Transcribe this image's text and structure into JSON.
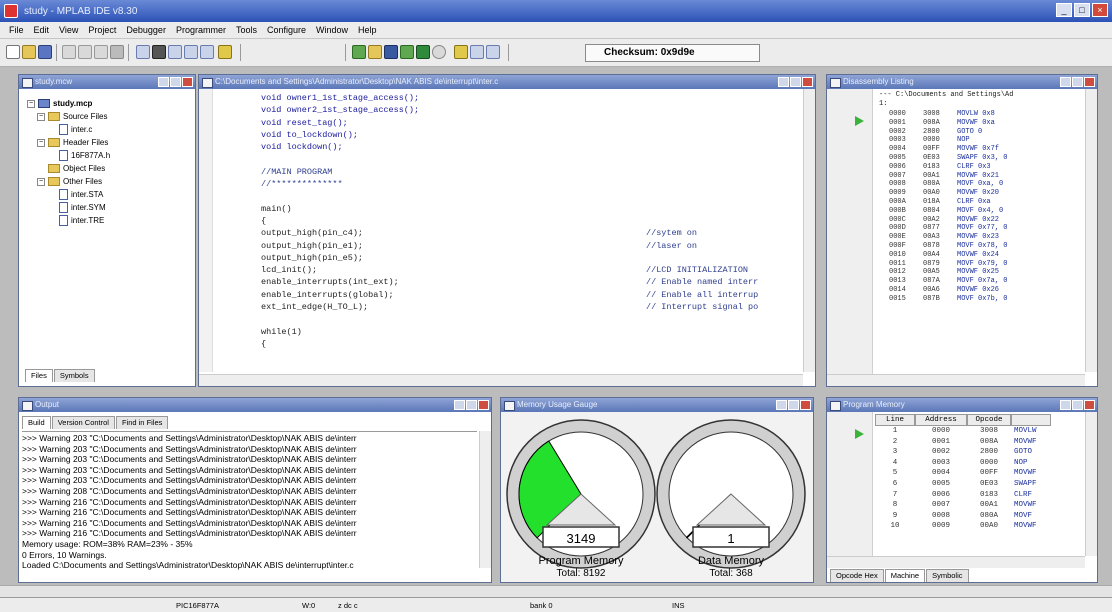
{
  "window": {
    "title": "study - MPLAB IDE v8.30"
  },
  "menu": [
    "File",
    "Edit",
    "View",
    "Project",
    "Debugger",
    "Programmer",
    "Tools",
    "Configure",
    "Window",
    "Help"
  ],
  "toolbar": {
    "checksum_label": "Checksum:",
    "checksum_value": "0x9d9e"
  },
  "project_window": {
    "title": "study.mcw",
    "tree": [
      {
        "label": "study.mcp",
        "type": "project",
        "depth": 0
      },
      {
        "label": "Source Files",
        "type": "folder",
        "depth": 1
      },
      {
        "label": "inter.c",
        "type": "file",
        "depth": 2
      },
      {
        "label": "Header Files",
        "type": "folder",
        "depth": 1
      },
      {
        "label": "16F877A.h",
        "type": "file",
        "depth": 2
      },
      {
        "label": "Object Files",
        "type": "folder",
        "depth": 1
      },
      {
        "label": "Other Files",
        "type": "folder",
        "depth": 1
      },
      {
        "label": "inter.STA",
        "type": "file",
        "depth": 2
      },
      {
        "label": "inter.SYM",
        "type": "file",
        "depth": 2
      },
      {
        "label": "inter.TRE",
        "type": "file",
        "depth": 2
      }
    ],
    "tabs": [
      "Files",
      "Symbols"
    ]
  },
  "editor": {
    "title": "C:\\Documents and Settings\\Administrator\\Desktop\\NAK ABIS de\\interrupt\\inter.c",
    "lines": [
      {
        "code": "void owner1_1st_stage_access();",
        "comment": ""
      },
      {
        "code": "void owner2_1st_stage_access();",
        "comment": ""
      },
      {
        "code": "void reset_tag();",
        "comment": ""
      },
      {
        "code": "void to_lockdown();",
        "comment": ""
      },
      {
        "code": "void lockdown();",
        "comment": ""
      },
      {
        "code": "",
        "comment": ""
      },
      {
        "code": "//MAIN PROGRAM",
        "comment": ""
      },
      {
        "code": "//**************",
        "comment": ""
      },
      {
        "code": "",
        "comment": ""
      },
      {
        "code": "main()",
        "comment": ""
      },
      {
        "code": "{",
        "comment": ""
      },
      {
        "code": "output_high(pin_c4);",
        "comment": "//sytem on"
      },
      {
        "code": "output_high(pin_e1);",
        "comment": "//laser on"
      },
      {
        "code": "output_high(pin_e5);",
        "comment": ""
      },
      {
        "code": "lcd_init();",
        "comment": "//LCD INITIALIZATION"
      },
      {
        "code": "enable_interrupts(int_ext);",
        "comment": "// Enable named interr"
      },
      {
        "code": "enable_interrupts(global);",
        "comment": "// Enable all interrup"
      },
      {
        "code": "ext_int_edge(H_TO_L);",
        "comment": "// Interrupt signal po"
      },
      {
        "code": "",
        "comment": ""
      },
      {
        "code": "while(1)",
        "comment": ""
      },
      {
        "code": "{",
        "comment": ""
      }
    ]
  },
  "disassembly": {
    "title": "Disassembly Listing",
    "header": "--- C:\\Documents and Settings\\Ad",
    "first": "1:",
    "rows": [
      [
        "0000",
        "3008",
        "MOVLW 0x8"
      ],
      [
        "0001",
        "008A",
        "MOVWF 0xa"
      ],
      [
        "0002",
        "2800",
        "GOTO 0"
      ],
      [
        "0003",
        "0000",
        "NOP"
      ],
      [
        "0004",
        "00FF",
        "MOVWF 0x7f"
      ],
      [
        "0005",
        "0E03",
        "SWAPF 0x3, 0"
      ],
      [
        "0006",
        "0183",
        "CLRF 0x3"
      ],
      [
        "0007",
        "00A1",
        "MOVWF 0x21"
      ],
      [
        "0008",
        "080A",
        "MOVF 0xa, 0"
      ],
      [
        "0009",
        "00A0",
        "MOVWF 0x20"
      ],
      [
        "000A",
        "018A",
        "CLRF 0xa"
      ],
      [
        "000B",
        "0804",
        "MOVF 0x4, 0"
      ],
      [
        "000C",
        "00A2",
        "MOVWF 0x22"
      ],
      [
        "000D",
        "0877",
        "MOVF 0x77, 0"
      ],
      [
        "000E",
        "00A3",
        "MOVWF 0x23"
      ],
      [
        "000F",
        "0878",
        "MOVF 0x78, 0"
      ],
      [
        "0010",
        "00A4",
        "MOVWF 0x24"
      ],
      [
        "0011",
        "0879",
        "MOVF 0x79, 0"
      ],
      [
        "0012",
        "00A5",
        "MOVWF 0x25"
      ],
      [
        "0013",
        "087A",
        "MOVF 0x7a, 0"
      ],
      [
        "0014",
        "00A6",
        "MOVWF 0x26"
      ],
      [
        "0015",
        "087B",
        "MOVF 0x7b, 0"
      ]
    ]
  },
  "output": {
    "title": "Output",
    "tabs": [
      "Build",
      "Version Control",
      "Find in Files"
    ],
    "lines": [
      ">>> Warning 203 \"C:\\Documents and Settings\\Administrator\\Desktop\\NAK ABIS de\\interr",
      ">>> Warning 203 \"C:\\Documents and Settings\\Administrator\\Desktop\\NAK ABIS de\\interr",
      ">>> Warning 203 \"C:\\Documents and Settings\\Administrator\\Desktop\\NAK ABIS de\\interr",
      ">>> Warning 203 \"C:\\Documents and Settings\\Administrator\\Desktop\\NAK ABIS de\\interr",
      ">>> Warning 203 \"C:\\Documents and Settings\\Administrator\\Desktop\\NAK ABIS de\\interr",
      ">>> Warning 208 \"C:\\Documents and Settings\\Administrator\\Desktop\\NAK ABIS de\\interr",
      ">>> Warning 216 \"C:\\Documents and Settings\\Administrator\\Desktop\\NAK ABIS de\\interr",
      ">>> Warning 216 \"C:\\Documents and Settings\\Administrator\\Desktop\\NAK ABIS de\\interr",
      ">>> Warning 216 \"C:\\Documents and Settings\\Administrator\\Desktop\\NAK ABIS de\\interr",
      ">>> Warning 216 \"C:\\Documents and Settings\\Administrator\\Desktop\\NAK ABIS de\\interr",
      "   Memory usage:   ROM=38%     RAM=23% - 35%",
      "   0 Errors,   10 Warnings.",
      "Loaded C:\\Documents and Settings\\Administrator\\Desktop\\NAK ABIS de\\interrupt\\inter.c"
    ]
  },
  "gauge": {
    "title": "Memory Usage Gauge",
    "program": {
      "value": "3149",
      "label": "Program Memory",
      "total": "Total: 8192",
      "fill_fraction": 0.384
    },
    "data": {
      "value": "1",
      "label": "Data Memory",
      "total": "Total: 368",
      "fill_fraction": 0.003
    },
    "fill_color": "#22e02c"
  },
  "program_memory": {
    "title": "Program Memory",
    "columns": [
      "Line",
      "Address",
      "Opcode",
      ""
    ],
    "rows": [
      [
        "1",
        "0000",
        "3008",
        "MOVLW"
      ],
      [
        "2",
        "0001",
        "008A",
        "MOVWF"
      ],
      [
        "3",
        "0002",
        "2800",
        "GOTO"
      ],
      [
        "4",
        "0003",
        "0000",
        "NOP"
      ],
      [
        "5",
        "0004",
        "00FF",
        "MOVWF"
      ],
      [
        "6",
        "0005",
        "0E03",
        "SWAPF"
      ],
      [
        "7",
        "0006",
        "0183",
        "CLRF"
      ],
      [
        "8",
        "0007",
        "00A1",
        "MOVWF"
      ],
      [
        "9",
        "0008",
        "080A",
        "MOVF"
      ],
      [
        "10",
        "0009",
        "00A0",
        "MOVWF"
      ]
    ],
    "tabs": [
      "Opcode Hex",
      "Machine",
      "Symbolic"
    ]
  },
  "status": {
    "device": "PIC16F877A",
    "w": "W:0",
    "flags": "z dc c",
    "bank": "bank 0",
    "mode": "INS"
  }
}
